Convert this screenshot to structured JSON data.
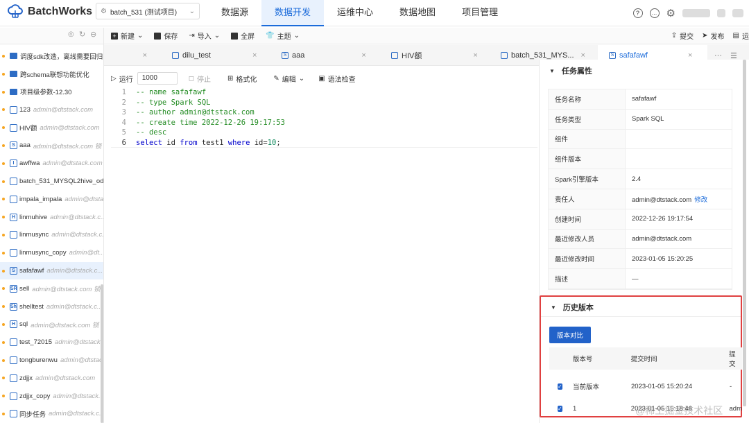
{
  "app": {
    "name": "BatchWorks",
    "project": "batch_531 (测试项目)"
  },
  "nav": [
    "数据源",
    "数据开发",
    "运维中心",
    "数据地图",
    "项目管理"
  ],
  "toolbar": {
    "new": "新建",
    "save": "保存",
    "import": "导入",
    "fullscreen": "全屏",
    "theme": "主题",
    "submit": "提交",
    "publish": "发布",
    "more": "运"
  },
  "sidebar": [
    {
      "name": "调度sdk改造，离线需要回归",
      "type": "folder",
      "owner": ""
    },
    {
      "name": "跨schema联想功能优化",
      "type": "folder",
      "owner": ""
    },
    {
      "name": "项目级参数-12.30",
      "type": "folder",
      "owner": ""
    },
    {
      "name": "123",
      "type": "file",
      "icon": "",
      "owner": "admin@dtstack.com"
    },
    {
      "name": "HIV额",
      "type": "file",
      "icon": "",
      "owner": "admin@dtstack.com"
    },
    {
      "name": "aaa",
      "type": "file",
      "icon": "S",
      "owner": "admin@dtstack.com 锁"
    },
    {
      "name": "awffwa",
      "type": "file",
      "icon": "I",
      "owner": "admin@dtstack.com"
    },
    {
      "name": "batch_531_MYSQL2hive_od",
      "type": "file",
      "icon": "",
      "owner": ""
    },
    {
      "name": "impala_impala",
      "type": "file",
      "icon": "",
      "owner": "admin@dtstack.c..."
    },
    {
      "name": "linmuhive",
      "type": "file",
      "icon": "H",
      "owner": "admin@dtstack.c..."
    },
    {
      "name": "linmusync",
      "type": "file",
      "icon": "",
      "owner": "admin@dtstack.c..."
    },
    {
      "name": "linmusync_copy",
      "type": "file",
      "icon": "",
      "owner": "admin@dt..."
    },
    {
      "name": "safafawf",
      "type": "file",
      "icon": "S",
      "owner": "admin@dtstack.c...",
      "selected": true
    },
    {
      "name": "sell",
      "type": "file",
      "icon": "SR",
      "owner": "admin@dtstack.com 锁"
    },
    {
      "name": "shelltest",
      "type": "file",
      "icon": "Sh",
      "owner": "admin@dtstack.c..."
    },
    {
      "name": "sql",
      "type": "file",
      "icon": "H",
      "owner": "admin@dtstack.com 锁"
    },
    {
      "name": "test_72015",
      "type": "file",
      "icon": "",
      "owner": "admin@dtstack.c..."
    },
    {
      "name": "tongburenwu",
      "type": "file",
      "icon": "",
      "owner": "admin@dtstac..."
    },
    {
      "name": "zdjjx",
      "type": "file",
      "icon": "",
      "owner": "admin@dtstack.com"
    },
    {
      "name": "zdjjx_copy",
      "type": "file",
      "icon": "",
      "owner": "admin@dtstack..."
    },
    {
      "name": "同步任务",
      "type": "file",
      "icon": "",
      "owner": "admin@dtstack.c..."
    }
  ],
  "tabs": [
    {
      "label": "",
      "icon": ""
    },
    {
      "label": "dilu_test",
      "icon": ""
    },
    {
      "label": "aaa",
      "icon": "S"
    },
    {
      "label": "HIV额",
      "icon": ""
    },
    {
      "label": "batch_531_MYS...",
      "icon": ""
    },
    {
      "label": "safafawf",
      "icon": "S",
      "active": true
    }
  ],
  "editor": {
    "run": "运行",
    "limit": "1000",
    "stop": "停止",
    "format": "格式化",
    "edit": "编辑",
    "syntax": "语法检查",
    "lines": [
      {
        "n": "1",
        "text": "-- name safafawf"
      },
      {
        "n": "2",
        "text": "-- type Spark SQL"
      },
      {
        "n": "3",
        "text": "-- author admin@dtstack.com"
      },
      {
        "n": "4",
        "text": "-- create time 2022-12-26 19:17:53"
      },
      {
        "n": "5",
        "text": "-- desc"
      }
    ],
    "sql": {
      "n": "6",
      "kw1": "select",
      "p1": " id ",
      "kw2": "from",
      "p2": " test1 ",
      "kw3": "where",
      "p3": " id=",
      "num": "10",
      "end": ";"
    }
  },
  "props": {
    "title": "任务属性",
    "rows": [
      {
        "k": "任务名称",
        "v": "safafawf"
      },
      {
        "k": "任务类型",
        "v": "Spark SQL"
      },
      {
        "k": "组件",
        "v": ""
      },
      {
        "k": "组件版本",
        "v": ""
      },
      {
        "k": "Spark引擎版本",
        "v": "2.4"
      },
      {
        "k": "责任人",
        "v": "admin@dtstack.com",
        "link": "修改"
      },
      {
        "k": "创建时间",
        "v": "2022-12-26 19:17:54"
      },
      {
        "k": "最近修改人员",
        "v": "admin@dtstack.com"
      },
      {
        "k": "最近修改时间",
        "v": "2023-01-05 15:20:25"
      },
      {
        "k": "描述",
        "v": "—"
      }
    ]
  },
  "history": {
    "title": "历史版本",
    "compare": "版本对比",
    "headers": [
      "版本号",
      "提交时间",
      "提交"
    ],
    "rows": [
      {
        "ver": "当前版本",
        "time": "2023-01-05 15:20:24",
        "by": "-"
      },
      {
        "ver": "1",
        "time": "2023-01-05 15:18:46",
        "by": "adm"
      }
    ]
  },
  "watermark": "@稀土掘金技术社区"
}
